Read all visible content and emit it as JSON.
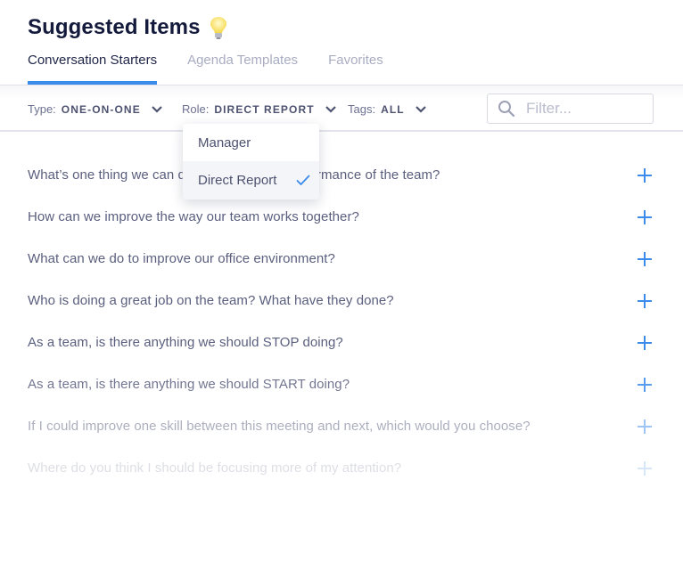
{
  "header": {
    "title": "Suggested Items",
    "title_icon": "lightbulb-icon"
  },
  "tabs": [
    {
      "label": "Conversation Starters",
      "active": true
    },
    {
      "label": "Agenda Templates",
      "active": false
    },
    {
      "label": "Favorites",
      "active": false
    }
  ],
  "filters": {
    "type": {
      "label": "Type:",
      "value": "ONE-ON-ONE"
    },
    "role": {
      "label": "Role:",
      "value": "DIRECT REPORT"
    },
    "tags": {
      "label": "Tags:",
      "value": "ALL"
    }
  },
  "search": {
    "placeholder": "Filter...",
    "value": ""
  },
  "role_dropdown": {
    "options": [
      {
        "label": "Manager",
        "selected": false
      },
      {
        "label": "Direct Report",
        "selected": true
      }
    ]
  },
  "items": [
    {
      "text": "What’s one thing we can do to improve the performance of the team?",
      "opacity": 1
    },
    {
      "text": "How can we improve the way our team works together?",
      "opacity": 1
    },
    {
      "text": "What can we do to improve our office environment?",
      "opacity": 1
    },
    {
      "text": "Who is doing a great job on the team? What have they done?",
      "opacity": 1
    },
    {
      "text": "As a team, is there anything we should STOP doing?",
      "opacity": 1
    },
    {
      "text": "As a team, is there anything we should START doing?",
      "opacity": 0.85
    },
    {
      "text": "If I could improve one skill between this meeting and next, which would you choose?",
      "opacity": 0.5
    },
    {
      "text": "Where do you think I should be focusing more of my attention?",
      "opacity": 0.2
    }
  ],
  "colors": {
    "accent": "#3b8beb",
    "title": "#141a3c",
    "text": "#5a5f7e",
    "muted": "#a9adc2"
  }
}
